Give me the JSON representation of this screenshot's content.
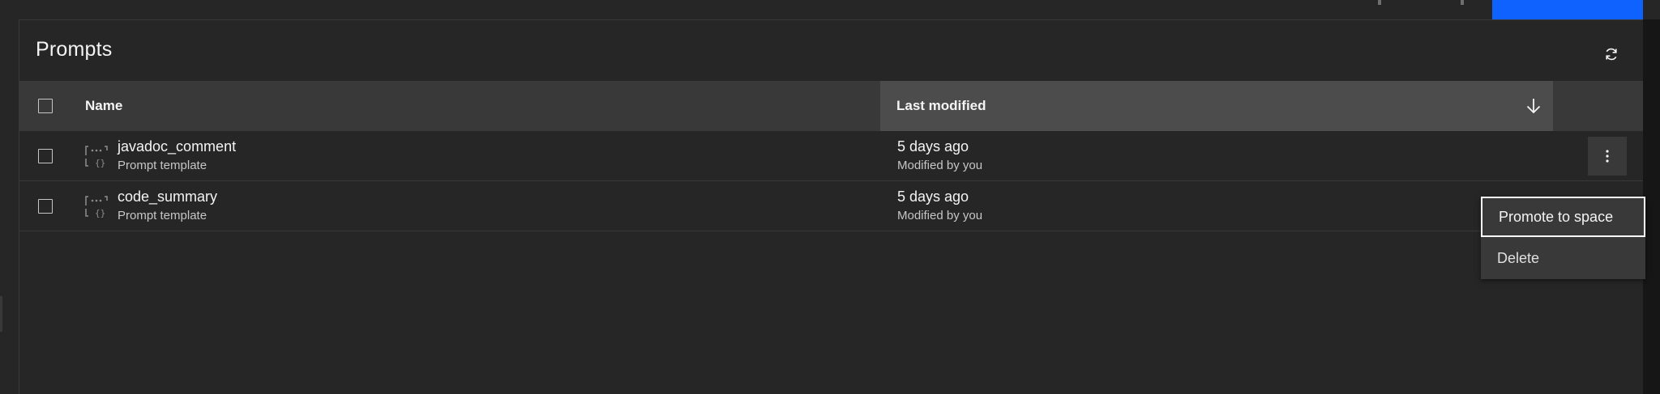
{
  "panel": {
    "title": "Prompts"
  },
  "icons": {
    "refresh": "refresh-icon",
    "sort": "arrow-down-icon",
    "row_type": "prompt-template-icon",
    "overflow": "overflow-menu-vertical-icon"
  },
  "table": {
    "columns": {
      "name": "Name",
      "last_modified": "Last modified"
    },
    "rows": [
      {
        "name": "javadoc_comment",
        "type": "Prompt template",
        "modified": "5 days ago",
        "modified_by": "Modified by you"
      },
      {
        "name": "code_summary",
        "type": "Prompt template",
        "modified": "5 days ago",
        "modified_by": "Modified by you"
      }
    ]
  },
  "overflow_menu": {
    "items": [
      {
        "label": "Promote to space"
      },
      {
        "label": "Delete"
      }
    ]
  },
  "colors": {
    "background": "#262626",
    "header": "#393939",
    "sorted_header": "#4c4c4c",
    "primary": "#0f62fe",
    "text": "#f4f4f4",
    "secondary_text": "#c6c6c6"
  }
}
